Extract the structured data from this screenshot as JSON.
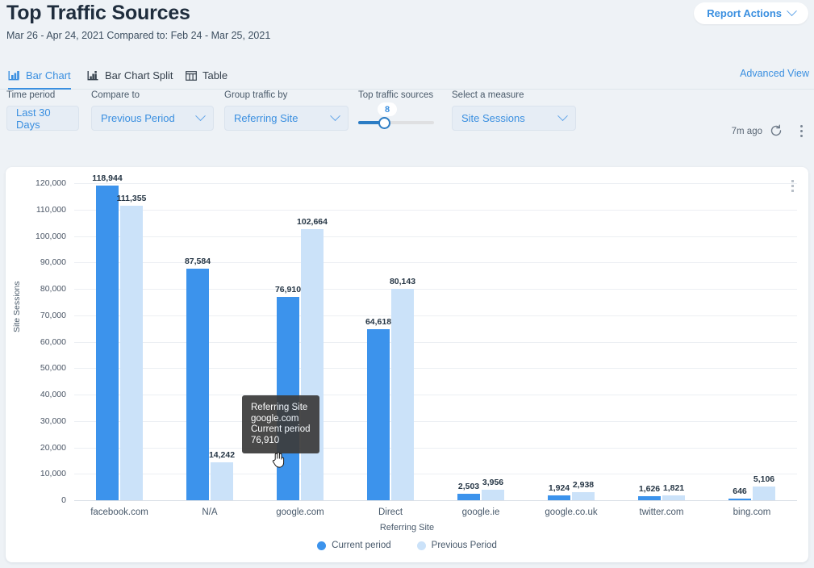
{
  "header": {
    "title": "Top Traffic Sources",
    "subtitle": "Mar 26 - Apr 24, 2021 Compared to: Feb 24 - Mar 25, 2021",
    "report_actions_label": "Report Actions",
    "chevron_icon": "chevron-down-icon"
  },
  "tabs": {
    "items": [
      {
        "label": "Bar Chart",
        "icon": "bar-chart-icon",
        "active": true
      },
      {
        "label": "Bar Chart Split",
        "icon": "bar-chart-split-icon",
        "active": false
      },
      {
        "label": "Table",
        "icon": "table-icon",
        "active": false
      }
    ],
    "advanced_view_label": "Advanced View"
  },
  "filters": {
    "time_period": {
      "label": "Time period",
      "value": "Last 30 Days"
    },
    "compare_to": {
      "label": "Compare to",
      "value": "Previous Period",
      "icon": "chevron-down-icon"
    },
    "group_traffic_by": {
      "label": "Group traffic by",
      "value": "Referring Site",
      "icon": "chevron-down-icon"
    },
    "top_traffic_sources": {
      "label": "Top traffic sources",
      "value": "8",
      "min": 1,
      "max": 25
    },
    "select_a_measure": {
      "label": "Select a measure",
      "value": "Site Sessions",
      "icon": "chevron-down-icon"
    },
    "timestamp": "7m ago",
    "refresh_icon": "refresh-icon",
    "kebab_icon": "more-vertical-icon"
  },
  "card": {
    "kebab_icon": "more-vertical-icon"
  },
  "tooltip": {
    "lines": [
      "Referring Site",
      "google.com",
      "Current period",
      "76,910"
    ],
    "cursor_icon": "pointer-hand-cursor"
  },
  "colors": {
    "current_period": "#3c93ec",
    "previous_period": "#cbe2f9",
    "accent": "#3a8fe0",
    "page_background": "#eef2f6",
    "card_background": "#ffffff",
    "tooltip_background": "#3c3c3c"
  },
  "chart_data": {
    "type": "bar",
    "title": "",
    "xlabel": "Referring Site",
    "ylabel": "Site Sessions",
    "ylim": [
      0,
      120000
    ],
    "yticks": [
      0,
      10000,
      20000,
      30000,
      40000,
      50000,
      60000,
      70000,
      80000,
      90000,
      100000,
      110000,
      120000
    ],
    "ytick_labels": [
      "0",
      "10,000",
      "20,000",
      "30,000",
      "40,000",
      "50,000",
      "60,000",
      "70,000",
      "80,000",
      "90,000",
      "100,000",
      "110,000",
      "120,000"
    ],
    "grid": true,
    "legend_position": "bottom",
    "categories": [
      "facebook.com",
      "N/A",
      "google.com",
      "Direct",
      "google.ie",
      "google.co.uk",
      "twitter.com",
      "bing.com"
    ],
    "series": [
      {
        "name": "Current period",
        "color": "#3c93ec",
        "values": [
          118944,
          87584,
          76910,
          64618,
          2503,
          1924,
          1626,
          646
        ],
        "labels": [
          "118,944",
          "87,584",
          "76,910",
          "64,618",
          "2,503",
          "1,924",
          "1,626",
          "646"
        ]
      },
      {
        "name": "Previous Period",
        "color": "#cbe2f9",
        "values": [
          111355,
          14242,
          102664,
          80143,
          3956,
          2938,
          1821,
          5106
        ],
        "labels": [
          "111,355",
          "14,242",
          "102,664",
          "80,143",
          "3,956",
          "2,938",
          "1,821",
          "5,106"
        ]
      }
    ]
  }
}
